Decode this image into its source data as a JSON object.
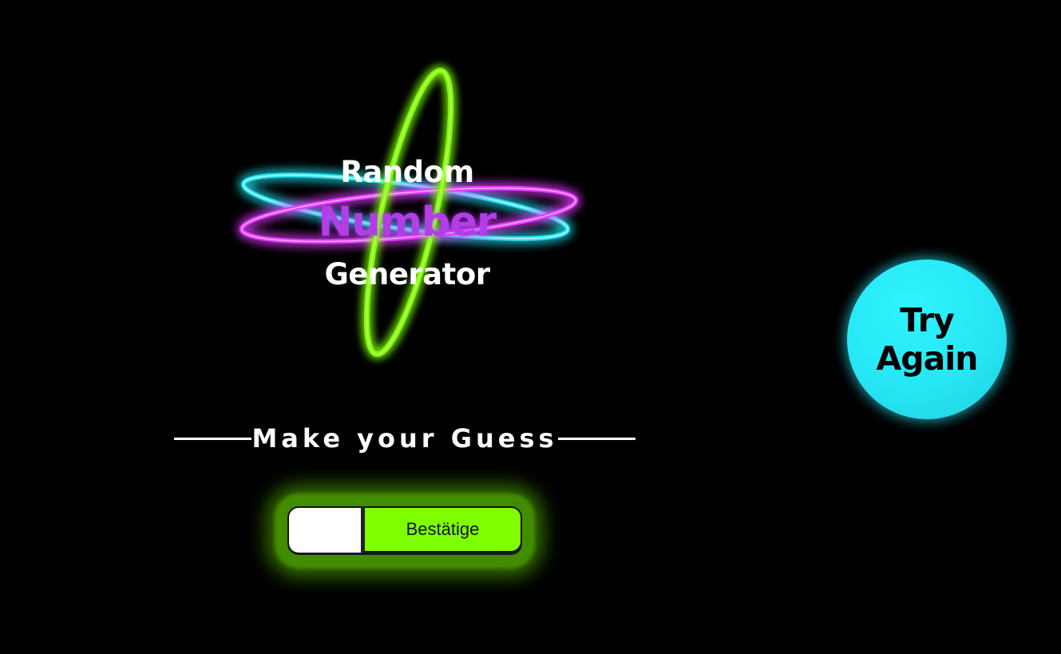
{
  "logo": {
    "line1": "Random",
    "line2": "Number",
    "line3": "Generator"
  },
  "guess": {
    "heading": "Make your Guess",
    "input_value": "",
    "input_placeholder": "",
    "confirm_label": "Bestätige"
  },
  "try_again": {
    "label": "Try Again"
  },
  "colors": {
    "background": "#000000",
    "accent_green": "#80ff00",
    "accent_cyan": "#27e6f4",
    "accent_magenta": "#e23cff",
    "number_text": "#b13ee6"
  }
}
